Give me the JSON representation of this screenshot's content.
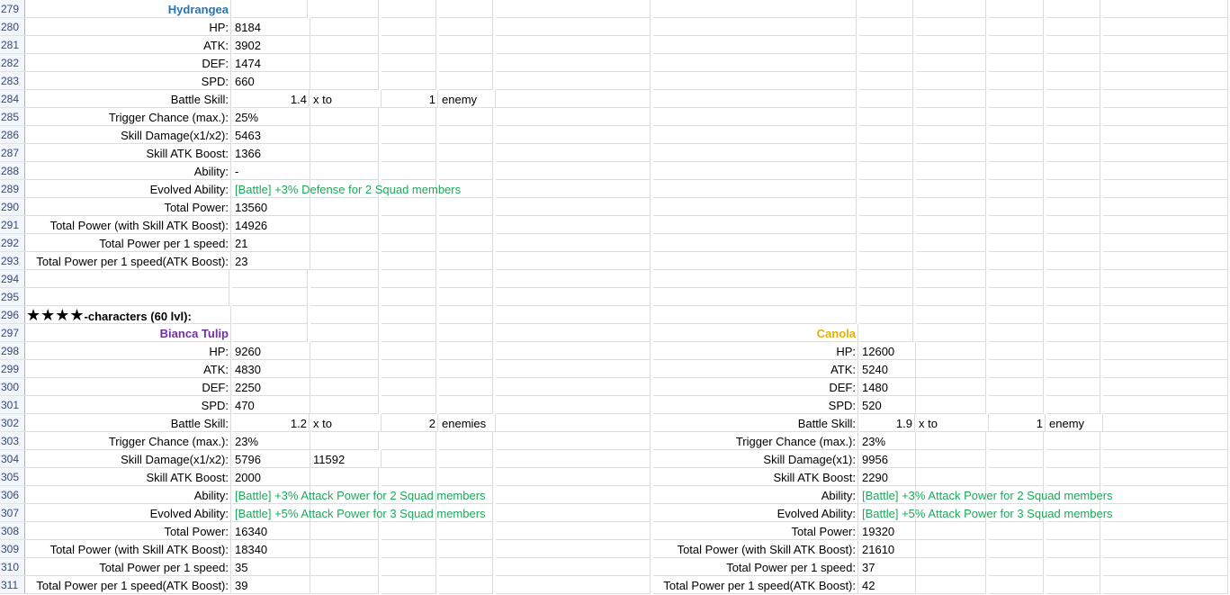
{
  "row_numbers": [
    "279",
    "280",
    "281",
    "282",
    "283",
    "284",
    "285",
    "286",
    "287",
    "288",
    "289",
    "290",
    "291",
    "292",
    "293",
    "294",
    "295",
    "296",
    "297",
    "298",
    "299",
    "300",
    "301",
    "302",
    "303",
    "304",
    "305",
    "306",
    "307",
    "308",
    "309",
    "310",
    "311"
  ],
  "hydrangea": {
    "name": "Hydrangea",
    "labels": {
      "hp": "HP:",
      "atk": "ATK:",
      "def": "DEF:",
      "spd": "SPD:",
      "battle_skill": "Battle Skill:",
      "trigger": "Trigger Chance (max.):",
      "skill_damage": "Skill Damage(x1/x2):",
      "skill_atk_boost": "Skill ATK Boost:",
      "ability": "Ability:",
      "evolved": "Evolved Ability:",
      "total_power": "Total Power:",
      "total_power_boost": "Total Power (with Skill ATK Boost):",
      "tp_per_speed": "Total Power per 1 speed:",
      "tp_per_speed_boost": "Total Power per 1 speed(ATK Boost):"
    },
    "hp": "8184",
    "atk": "3902",
    "def": "1474",
    "spd": "660",
    "skill_mult": "1.4",
    "skill_x_to": "x to",
    "skill_targets": "1",
    "skill_target_word": "enemy",
    "trigger": "25%",
    "skill_damage": "5463",
    "skill_atk_boost": "1366",
    "ability": "-",
    "evolved": "[Battle] +3% Defense for 2 Squad members",
    "total_power": "13560",
    "total_power_boost": "14926",
    "tp_per_speed": "21",
    "tp_per_speed_boost": "23"
  },
  "section": {
    "stars": "★★★★",
    "heading": "-characters (60 lvl):"
  },
  "bianca": {
    "name": "Bianca Tulip",
    "labels": {
      "hp": "HP:",
      "atk": "ATK:",
      "def": "DEF:",
      "spd": "SPD:",
      "battle_skill": "Battle Skill:",
      "trigger": "Trigger Chance (max.):",
      "skill_damage": "Skill Damage(x1/x2):",
      "skill_atk_boost": "Skill ATK Boost:",
      "ability": "Ability:",
      "evolved": "Evolved Ability:",
      "total_power": "Total Power:",
      "total_power_boost": "Total Power (with Skill ATK Boost):",
      "tp_per_speed": "Total Power per 1 speed:",
      "tp_per_speed_boost": "Total Power per 1 speed(ATK Boost):"
    },
    "hp": "9260",
    "atk": "4830",
    "def": "2250",
    "spd": "470",
    "skill_mult": "1.2",
    "skill_x_to": "x to",
    "skill_targets": "2",
    "skill_target_word": "enemies",
    "trigger": "23%",
    "skill_damage": "5796",
    "skill_damage_x2": "11592",
    "skill_atk_boost": "2000",
    "ability": "[Battle] +3% Attack Power for 2 Squad members",
    "evolved": "[Battle] +5% Attack Power for 3 Squad members",
    "total_power": "16340",
    "total_power_boost": "18340",
    "tp_per_speed": "35",
    "tp_per_speed_boost": "39"
  },
  "canola": {
    "name": "Canola",
    "labels": {
      "hp": "HP:",
      "atk": "ATK:",
      "def": "DEF:",
      "spd": "SPD:",
      "battle_skill": "Battle Skill:",
      "trigger": "Trigger Chance (max.):",
      "skill_damage": "Skill Damage(x1):",
      "skill_atk_boost": "Skill ATK Boost:",
      "ability": "Ability:",
      "evolved": "Evolved Ability:",
      "total_power": "Total Power:",
      "total_power_boost": "Total Power (with Skill ATK Boost):",
      "tp_per_speed": "Total Power per 1 speed:",
      "tp_per_speed_boost": "Total Power per 1 speed(ATK Boost):"
    },
    "hp": "12600",
    "atk": "5240",
    "def": "1480",
    "spd": "520",
    "skill_mult": "1.9",
    "skill_x_to": "x to",
    "skill_targets": "1",
    "skill_target_word": "enemy",
    "trigger": "23%",
    "skill_damage": "9956",
    "skill_atk_boost": "2290",
    "ability": "[Battle] +3% Attack Power for 2 Squad members",
    "evolved": "[Battle] +5% Attack Power for 3 Squad members",
    "total_power": "19320",
    "total_power_boost": "21610",
    "tp_per_speed": "37",
    "tp_per_speed_boost": "42"
  },
  "colors": {
    "hydrangea_title": "#2a74b0",
    "bianca_title": "#7030a0",
    "canola_title": "#e6b000",
    "ability_text": "#1fa85a",
    "row_header_bg": "#f2f5fa",
    "gridline": "#dadcdd"
  }
}
